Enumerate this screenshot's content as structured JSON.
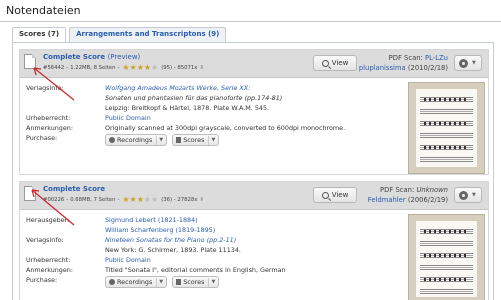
{
  "page": {
    "title": "Notendateien"
  },
  "tabs": [
    {
      "label": "Scores (7)",
      "active": true
    },
    {
      "label": "Arrangements and Transcriptons (9)",
      "active": false
    }
  ],
  "items": [
    {
      "title": "Complete Score",
      "title_suffix": "(Preview)",
      "meta_id": "#56442",
      "meta_size": "1.22MB, 8 Seiten",
      "meta_dl": "(95) - 85071x",
      "rating": 3.5,
      "view_label": "View",
      "scan_label": "PDF Scan:",
      "scan_user": "PL-LZu",
      "scan_line2_user": "pluplanissima",
      "scan_line2_date": "(2010/2/18)",
      "details": [
        {
          "label": "Verlagsinfo:",
          "lines": [
            "Wolfgang Amadeus Mozarts Werke, Serie XX:",
            "Sonaten und phantasien für das pianoforte (pp.174-81)",
            "Leipzig: Breitkopf & Härtel, 1878. Plate W.A.M. 545."
          ]
        },
        {
          "label": "Urheberrecht:",
          "lines": [
            "Public Domain"
          ]
        },
        {
          "label": "Anmerkungen:",
          "lines": [
            "Originally scanned at 300dpi grayscale, converted to 600dpi monochrome."
          ]
        },
        {
          "label": "Purchase:",
          "lines": []
        }
      ],
      "buttons": [
        "Recordings",
        "Scores"
      ]
    },
    {
      "title": "Complete Score",
      "title_suffix": "",
      "meta_id": "#00226",
      "meta_size": "0.68MB, 7 Seiten",
      "meta_dl": "(36) - 27828x",
      "rating": 3,
      "view_label": "View",
      "scan_label": "PDF Scan:",
      "scan_user": "Unknown",
      "scan_line2_user": "Feldmahler",
      "scan_line2_date": "(2006/2/19)",
      "details": [
        {
          "label": "Herausgeber:",
          "lines": [
            "Sigmund Lebert (1821-1884)",
            "William Scharfenberg (1819-1895)"
          ]
        },
        {
          "label": "Verlagsinfo:",
          "lines": [
            "Nineteen Sonatas for the Piano (pp.2-11)",
            "New York: G. Schirmer, 1893. Plate 11134."
          ]
        },
        {
          "label": "Urheberrecht:",
          "lines": [
            "Public Domain"
          ]
        },
        {
          "label": "Anmerkungen:",
          "lines": [
            "Titled \"Sonata I\", editorial comments in English, German"
          ]
        },
        {
          "label": "Purchase:",
          "lines": []
        }
      ],
      "buttons": [
        "Recordings",
        "Scores"
      ]
    }
  ],
  "colors": {
    "link": "#2a5db0",
    "header_bg": "#dcdcdc",
    "arrow": "#d0282d",
    "star": "#c9a227"
  }
}
